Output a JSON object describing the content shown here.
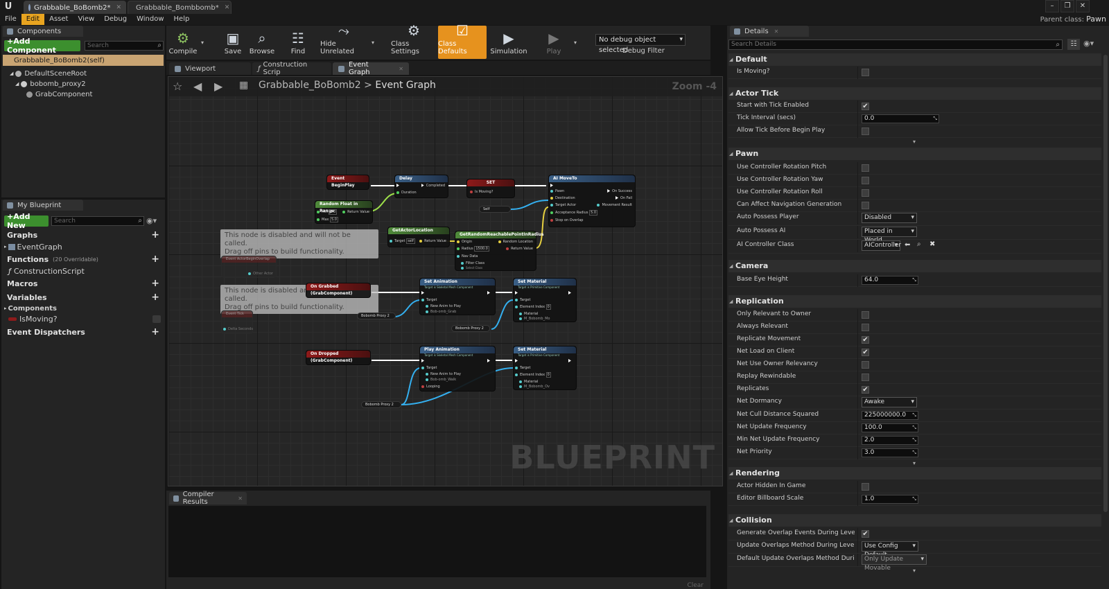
{
  "titlebar": {
    "tabs": [
      {
        "label": "Grabbable_BoBomb2*"
      },
      {
        "label": "Grabbable_Bombbomb*"
      }
    ]
  },
  "menu": {
    "items": [
      "File",
      "Edit",
      "Asset",
      "View",
      "Debug",
      "Window",
      "Help"
    ],
    "parent_class_label": "Parent class:",
    "parent_class_value": "Pawn"
  },
  "components": {
    "tab_label": "Components",
    "add_button": "+Add Component",
    "search_placeholder": "Search",
    "self_item": "Grabbable_BoBomb2(self)",
    "tree": [
      "DefaultSceneRoot",
      "bobomb_proxy2",
      "GrabComponent"
    ]
  },
  "my_blueprint": {
    "tab_label": "My Blueprint",
    "add_button": "+Add New",
    "search_placeholder": "Search",
    "graphs_label": "Graphs",
    "event_graph": "EventGraph",
    "functions_label": "Functions",
    "functions_count": "(20 Overridable)",
    "construction_script": "ConstructionScript",
    "macros_label": "Macros",
    "variables_label": "Variables",
    "components_label": "Components",
    "is_moving_var": "IsMoving?",
    "event_dispatchers_label": "Event Dispatchers"
  },
  "toolbar": {
    "buttons": [
      "Compile",
      "Save",
      "Browse",
      "Find",
      "Hide Unrelated",
      "Class Settings",
      "Class Defaults",
      "Simulation",
      "Play"
    ],
    "debug_select": "No debug object selected",
    "debug_filter_label": "Debug Filter"
  },
  "graph_tabs": [
    "Viewport",
    "Construction Scrip",
    "Event Graph"
  ],
  "graph": {
    "breadcrumb_root": "Grabbable_BoBomb2",
    "breadcrumb_sep": ">",
    "breadcrumb_leaf": "Event Graph",
    "zoom": "Zoom -4",
    "watermark": "BLUEPRINT",
    "disabled_note": "This node is disabled and will not be called.",
    "disabled_note2": "Drag off pins to build functionality.",
    "nodes": {
      "begin_play": "Event BeginPlay",
      "delay": "Delay",
      "delay_completed": "Completed",
      "delay_duration": "Duration",
      "set": "SET",
      "is_moving": "Is Moving?",
      "ai_move": "AI MoveTo",
      "ai_pawn": "Pawn",
      "ai_dest": "Destination",
      "ai_target": "Target Actor",
      "ai_accept": "Acceptance Radius",
      "ai_accept_val": "5.0",
      "ai_stop": "Stop on Overlap",
      "ai_success": "On Success",
      "ai_fail": "On Fail",
      "ai_result": "Movement Result",
      "self": "Self",
      "random_float": "Random Float in Range",
      "rf_min": "Min",
      "rf_min_val": "1.0",
      "rf_max": "Max",
      "rf_max_val": "5.0",
      "rf_return": "Return Value",
      "get_actor_loc": "GetActorLocation",
      "gal_target": "Target",
      "gal_target_val": "self",
      "gal_return": "Return Value",
      "random_reach": "GetRandomReachablePointInRadius",
      "rr_origin": "Origin",
      "rr_radius": "Radius",
      "rr_radius_val": "1500.0",
      "rr_navdata": "Nav Data",
      "rr_filter": "Filter Class",
      "rr_filter_val": "Select Class",
      "rr_random_loc": "Random Location",
      "rr_return": "Return Value",
      "actor_overlap": "Event ActorBeginOverlap",
      "other_actor": "Other Actor",
      "event_tick": "Event Tick",
      "delta_seconds": "Delta Seconds",
      "on_grabbed": "On Grabbed (GrabComponent)",
      "set_animation": "Set Animation",
      "set_anim_sub": "Target is Skeletal Mesh Component",
      "sa_target": "Target",
      "sa_new_anim": "New Anim to Play",
      "sa_new_anim_val": "Bob-omb_Grab",
      "set_material1": "Set Material",
      "sm_sub": "Target is Primitive Component",
      "sm_target": "Target",
      "sm_element": "Element Index",
      "sm_element_val": "0",
      "sm_material": "Material",
      "sm_material_val": "M_Bobomb_Mo",
      "proxy_a": "Bobomb Proxy 2",
      "proxy_b": "Bobomb Proxy 2",
      "on_dropped": "On Dropped (GrabComponent)",
      "play_animation": "Play Animation",
      "pa_target": "Target",
      "pa_new_anim": "New Anim to Play",
      "pa_new_anim_val": "Bob-omb_Walk",
      "pa_looping": "Looping",
      "set_material2": "Set Material",
      "sm2_target": "Target",
      "sm2_element": "Element Index",
      "sm2_element_val": "0",
      "sm2_material": "Material",
      "sm2_material_val": "M_Bobomb_Ov",
      "proxy_c": "Bobomb Proxy 2"
    }
  },
  "compiler": {
    "tab_label": "Compiler Results",
    "clear_label": "Clear"
  },
  "details": {
    "tab_label": "Details",
    "search_placeholder": "Search Details",
    "categories": {
      "default": "Default",
      "actor_tick": "Actor Tick",
      "pawn": "Pawn",
      "camera": "Camera",
      "replication": "Replication",
      "rendering": "Rendering",
      "collision": "Collision"
    },
    "rows": {
      "is_moving": "Is Moving?",
      "start_tick": "Start with Tick Enabled",
      "tick_interval": "Tick Interval (secs)",
      "tick_interval_val": "0.0",
      "allow_tick": "Allow Tick Before Begin Play",
      "rot_pitch": "Use Controller Rotation Pitch",
      "rot_yaw": "Use Controller Rotation Yaw",
      "rot_roll": "Use Controller Rotation Roll",
      "affect_nav": "Can Affect Navigation Generation",
      "auto_player": "Auto Possess Player",
      "auto_player_val": "Disabled",
      "auto_ai": "Auto Possess AI",
      "auto_ai_val": "Placed in World",
      "ai_controller": "AI Controller Class",
      "ai_controller_val": "AIController",
      "base_eye": "Base Eye Height",
      "base_eye_val": "64.0",
      "only_owner": "Only Relevant to Owner",
      "always_rel": "Always Relevant",
      "rep_movement": "Replicate Movement",
      "net_load": "Net Load on Client",
      "net_owner_rel": "Net Use Owner Relevancy",
      "replay_rew": "Replay Rewindable",
      "replicates": "Replicates",
      "net_dormancy": "Net Dormancy",
      "net_dormancy_val": "Awake",
      "net_cull": "Net Cull Distance Squared",
      "net_cull_val": "225000000.0",
      "net_update": "Net Update Frequency",
      "net_update_val": "100.0",
      "min_net_update": "Min Net Update Frequency",
      "min_net_update_val": "2.0",
      "net_priority": "Net Priority",
      "net_priority_val": "3.0",
      "actor_hidden": "Actor Hidden In Game",
      "billboard": "Editor Billboard Scale",
      "billboard_val": "1.0",
      "gen_overlap": "Generate Overlap Events During Level Streaming",
      "update_overlap": "Update Overlaps Method During Level Streaming",
      "update_overlap_val": "Use Config Default",
      "default_overlap": "Default Update Overlaps Method During Level Str",
      "default_overlap_val": "Only Update Movable"
    },
    "checks": {
      "is_moving": false,
      "start_tick": true,
      "allow_tick": false,
      "rot_pitch": false,
      "rot_yaw": false,
      "rot_roll": false,
      "affect_nav": false,
      "only_owner": false,
      "always_rel": false,
      "rep_movement": true,
      "net_load": true,
      "net_owner_rel": false,
      "replay_rew": false,
      "replicates": true,
      "actor_hidden": false,
      "gen_overlap": true
    }
  }
}
